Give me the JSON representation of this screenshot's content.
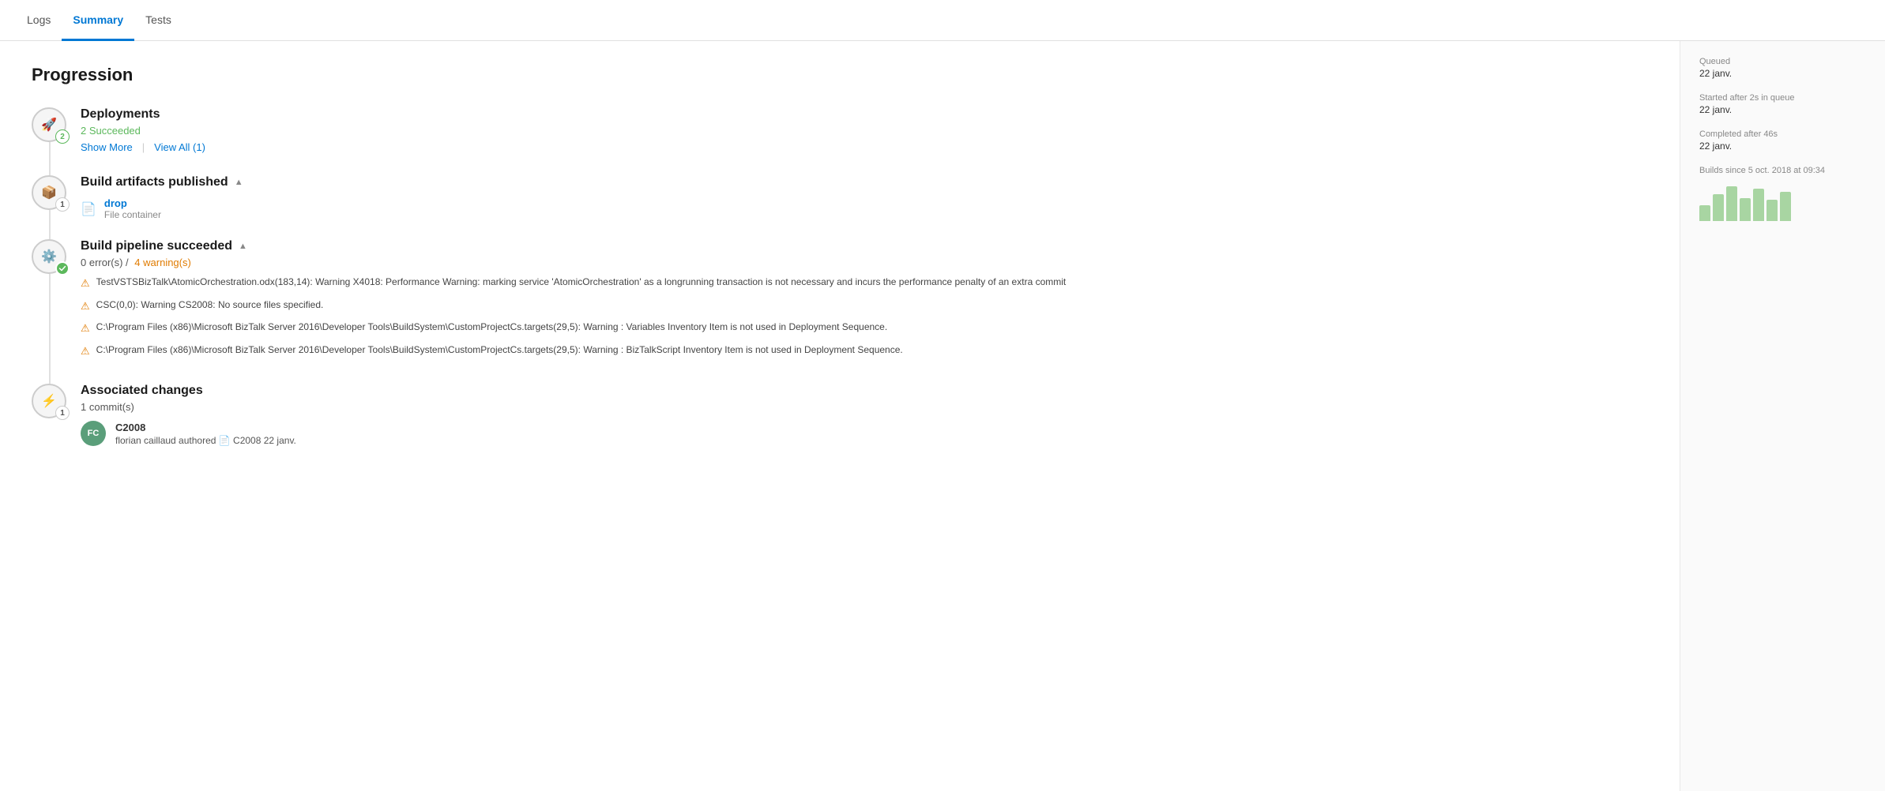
{
  "nav": {
    "tabs": [
      {
        "label": "Logs",
        "active": false
      },
      {
        "label": "Summary",
        "active": true
      },
      {
        "label": "Tests",
        "active": false
      }
    ]
  },
  "progression": {
    "title": "Progression",
    "stages": [
      {
        "id": "deployments",
        "title": "Deployments",
        "badge": "2",
        "badge_type": "success",
        "subtitle": "2 Succeeded",
        "show_more": "Show More",
        "view_all": "View All (1)"
      },
      {
        "id": "artifacts",
        "title": "Build artifacts published",
        "badge": "1",
        "artifact_name": "drop",
        "artifact_desc": "File container"
      },
      {
        "id": "pipeline",
        "title": "Build pipeline succeeded",
        "badge": "",
        "subtitle_neutral": "0 error(s) /",
        "subtitle_warning": "4 warning(s)",
        "warnings": [
          "TestVSTSBizTalk\\AtomicOrchestration.odx(183,14): Warning X4018: Performance Warning: marking service 'AtomicOrchestration' as a longrunning transaction is not necessary and incurs the performance penalty of an extra commit",
          "CSC(0,0): Warning CS2008: No source files specified.",
          "C:\\Program Files (x86)\\Microsoft BizTalk Server 2016\\Developer Tools\\BuildSystem\\CustomProjectCs.targets(29,5): Warning : Variables Inventory Item is not used in Deployment Sequence.",
          "C:\\Program Files (x86)\\Microsoft BizTalk Server 2016\\Developer Tools\\BuildSystem\\CustomProjectCs.targets(29,5): Warning : BizTalkScript Inventory Item is not used in Deployment Sequence."
        ]
      },
      {
        "id": "changes",
        "title": "Associated changes",
        "subtitle": "1 commit(s)",
        "badge": "1",
        "commit": {
          "id": "C2008",
          "author": "florian caillaud authored",
          "ref": "C2008",
          "date": "22 janv.",
          "avatar_initials": "FC"
        }
      }
    ]
  },
  "sidebar": {
    "builds_since_label": "Builds since 5 oct. 2018 at 09:34",
    "queued_label": "Queued",
    "queued_value": "22 janv.",
    "started_label": "Started after 2s in queue",
    "started_value": "22 janv.",
    "completed_label": "Completed after 46s",
    "completed_value": "22 janv.",
    "chart_bars": [
      20,
      35,
      45,
      30,
      42,
      28,
      38
    ]
  }
}
